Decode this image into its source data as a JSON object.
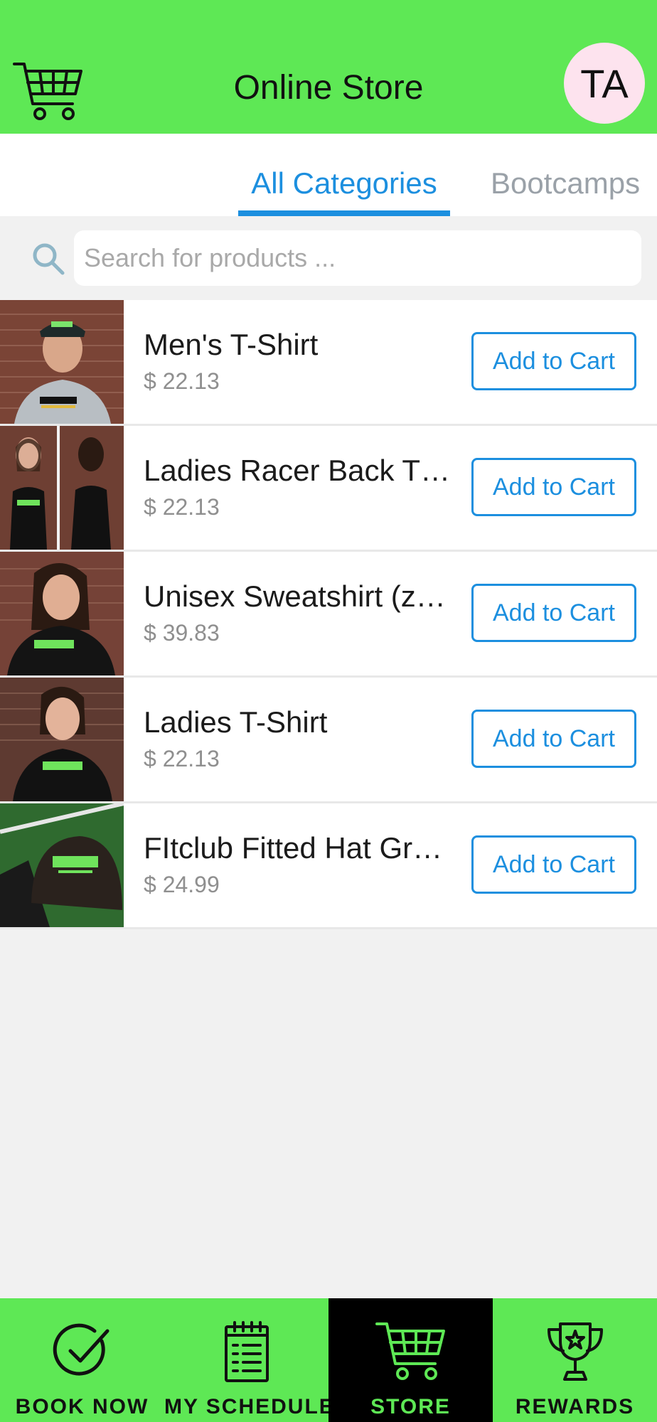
{
  "header": {
    "title": "Online Store",
    "avatar_initials": "TA",
    "icon": "shopping-cart-icon"
  },
  "tabs": [
    {
      "label": "All Categories",
      "active": true
    },
    {
      "label": "Bootcamps",
      "active": false
    }
  ],
  "search": {
    "placeholder": "Search for products ...",
    "value": "",
    "icon": "search-icon"
  },
  "products": [
    {
      "name": "Men's T-Shirt",
      "price": "$ 22.13",
      "button": "Add to Cart"
    },
    {
      "name": "Ladies Racer Back T…",
      "price": "$ 22.13",
      "button": "Add to Cart"
    },
    {
      "name": "Unisex Sweatshirt (z…",
      "price": "$ 39.83",
      "button": "Add to Cart"
    },
    {
      "name": "Ladies T-Shirt",
      "price": "$ 22.13",
      "button": "Add to Cart"
    },
    {
      "name": "FItclub Fitted Hat Gr…",
      "price": "$ 24.99",
      "button": "Add to Cart"
    }
  ],
  "bottom_nav": [
    {
      "label": "BOOK NOW",
      "icon": "check-circle-icon",
      "active": false
    },
    {
      "label": "MY SCHEDULE",
      "icon": "calendar-icon",
      "active": false
    },
    {
      "label": "STORE",
      "icon": "shopping-cart-icon",
      "active": true
    },
    {
      "label": "REWARDS",
      "icon": "trophy-icon",
      "active": false
    }
  ],
  "colors": {
    "brand_green": "#5ee855",
    "accent_blue": "#1c8fdf",
    "background": "#f1f1f1",
    "avatar_bg": "#fde3ee"
  }
}
